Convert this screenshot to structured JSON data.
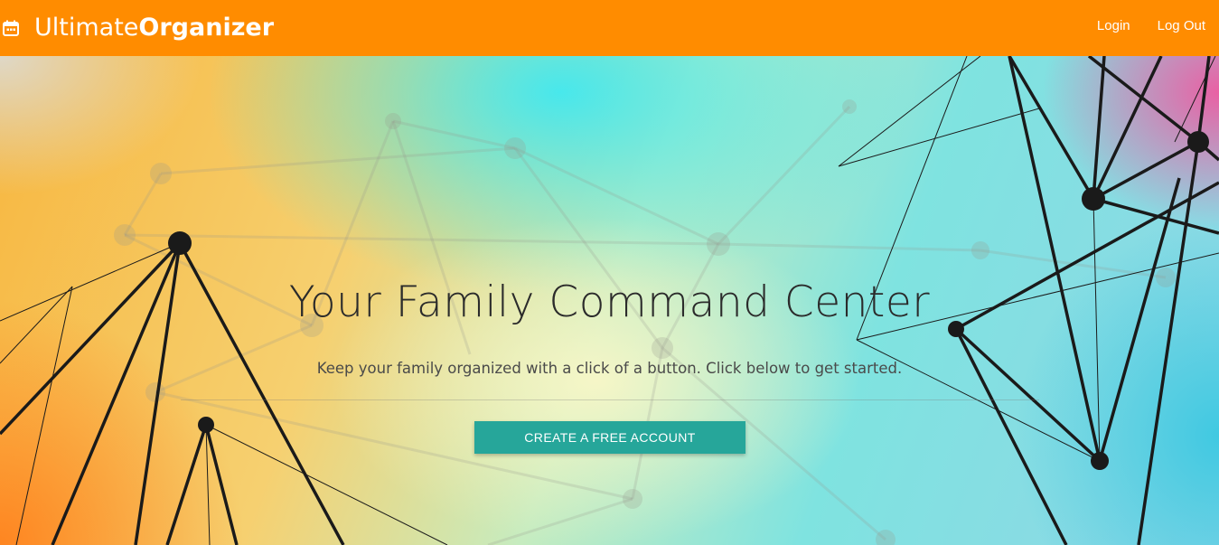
{
  "navbar": {
    "brand_light": "Ultimate",
    "brand_bold": "Organizer",
    "brand_icon": "calendar-icon",
    "links": [
      "Login",
      "Log Out"
    ],
    "background": "#ff8c00"
  },
  "hero": {
    "title": "Your Family Command Center",
    "subtitle": "Keep your family organized with a click of a button. Click below to get started.",
    "cta_label": "CREATE A FREE ACCOUNT",
    "cta_color": "#26a69a"
  }
}
